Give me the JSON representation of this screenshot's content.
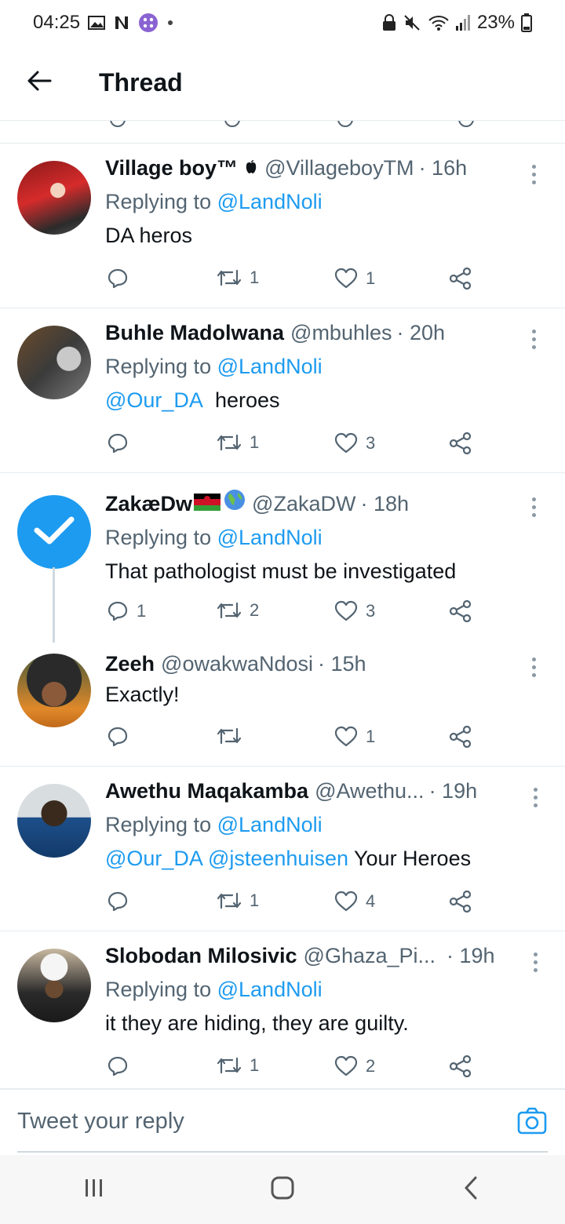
{
  "status_bar": {
    "time": "04:25",
    "battery": "23%"
  },
  "header": {
    "title": "Thread"
  },
  "tweets": [
    {
      "name": "Village boy™",
      "badge": "",
      "handle": "@VillageboyTM",
      "time": "· 16h",
      "replying_label": "Replying to",
      "replying_to": "@LandNoli",
      "text": "DA heros",
      "mentions": "",
      "reply_count": "",
      "retweet_count": "1",
      "like_count": "1"
    },
    {
      "name": "Buhle Madolwana",
      "handle": "@mbuhles",
      "time": "· 20h",
      "replying_label": "Replying to",
      "replying_to": "@LandNoli",
      "mentions": "@Our_DA",
      "text": "heroes",
      "reply_count": "",
      "retweet_count": "1",
      "like_count": "3"
    },
    {
      "name": "ZakæDw",
      "handle": "@ZakaDW",
      "time": "· 18h",
      "replying_label": "Replying to",
      "replying_to": "@LandNoli",
      "mentions": "",
      "text": "That pathologist must be investigated",
      "reply_count": "1",
      "retweet_count": "2",
      "like_count": "3"
    },
    {
      "name": "Zeeh",
      "handle": "@owakwaNdosi",
      "time": "· 15h",
      "mentions": "",
      "text": "Exactly!",
      "reply_count": "",
      "retweet_count": "",
      "like_count": "1"
    },
    {
      "name": "Awethu Maqakamba",
      "handle": "@Awethu...",
      "time": "· 19h",
      "replying_label": "Replying to",
      "replying_to": "@LandNoli",
      "mentions": "@Our_DA @jsteenhuisen",
      "text": "Your Heroes",
      "reply_count": "",
      "retweet_count": "1",
      "like_count": "4"
    },
    {
      "name": "Slobodan Milosivic",
      "handle": "@Ghaza_Pi...",
      "time": "· 19h",
      "replying_label": "Replying to",
      "replying_to": "@LandNoli",
      "mentions": "",
      "text": "it they are hiding, they are guilty.",
      "reply_count": "",
      "retweet_count": "1",
      "like_count": "2"
    }
  ],
  "reply_bar": {
    "placeholder": "Tweet your reply"
  },
  "icons": {
    "back": "arrow-left-icon",
    "more": "more-vertical-icon",
    "reply": "comment-icon",
    "retweet": "retweet-icon",
    "like": "heart-icon",
    "share": "share-icon",
    "camera": "camera-icon",
    "verified": "checkmark-badge-icon"
  },
  "colors": {
    "accent": "#1d9bf0",
    "text": "#0f1419",
    "muted": "#536471",
    "divider": "#e6ecf0"
  }
}
